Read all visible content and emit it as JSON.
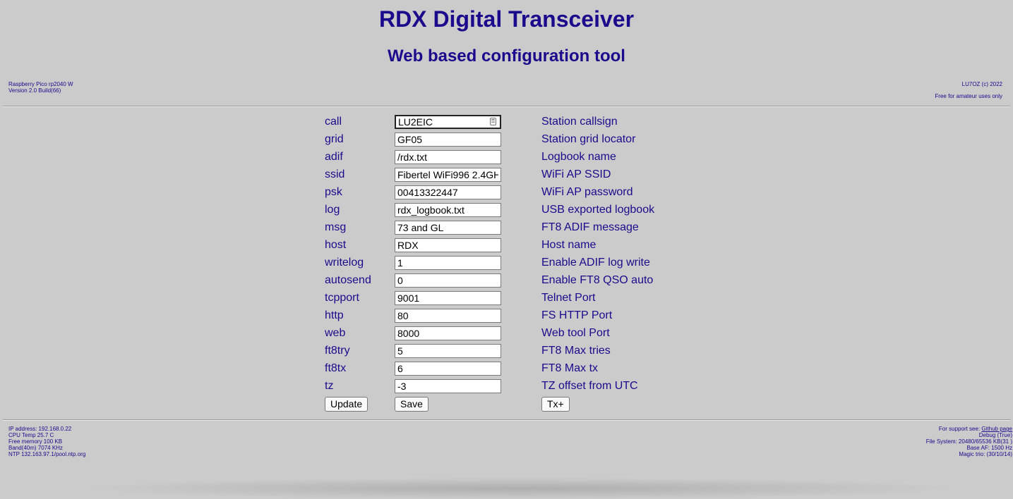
{
  "header": {
    "title": "RDX Digital Transceiver",
    "subtitle": "Web based configuration tool",
    "left_line1": "Raspberry Pico rp2040 W",
    "left_line2": "Version 2.0 Build(66)",
    "right_line1": "LU7OZ (c) 2022",
    "right_line2": "Free for amateur uses only"
  },
  "fields": [
    {
      "label": "call",
      "value": "LU2EIC",
      "description": "Station callsign"
    },
    {
      "label": "grid",
      "value": "GF05",
      "description": "Station grid locator"
    },
    {
      "label": "adif",
      "value": "/rdx.txt",
      "description": "Logbook name"
    },
    {
      "label": "ssid",
      "value": "Fibertel WiFi996 2.4GHz",
      "description": "WiFi AP SSID"
    },
    {
      "label": "psk",
      "value": "00413322447",
      "description": "WiFi AP password"
    },
    {
      "label": "log",
      "value": "rdx_logbook.txt",
      "description": "USB exported logbook"
    },
    {
      "label": "msg",
      "value": "73 and GL",
      "description": "FT8 ADIF message"
    },
    {
      "label": "host",
      "value": "RDX",
      "description": "Host name"
    },
    {
      "label": "writelog",
      "value": "1",
      "description": "Enable ADIF log write"
    },
    {
      "label": "autosend",
      "value": "0",
      "description": "Enable FT8 QSO auto"
    },
    {
      "label": "tcpport",
      "value": "9001",
      "description": "Telnet Port"
    },
    {
      "label": "http",
      "value": "80",
      "description": "FS HTTP Port"
    },
    {
      "label": "web",
      "value": "8000",
      "description": "Web tool Port"
    },
    {
      "label": "ft8try",
      "value": "5",
      "description": "FT8 Max tries"
    },
    {
      "label": "ft8tx",
      "value": "6",
      "description": "FT8 Max tx"
    },
    {
      "label": "tz",
      "value": "-3",
      "description": "TZ offset from UTC"
    }
  ],
  "buttons": {
    "update": "Update",
    "save": "Save",
    "tx": "Tx+"
  },
  "footer": {
    "left": [
      "IP address: 192.168.0.22",
      "CPU Temp 25.7 C",
      "Free memory 100 KB",
      "Band(40m) 7074 KHz",
      "NTP 132.163.97.1/pool.ntp.org"
    ],
    "support_prefix": "For support see: ",
    "support_link": "Github page",
    "right": [
      "Debug (True)",
      "File System: 20480/65536 KB(31 )",
      "Base AF: 1500 Hz",
      "Magic trio: (30/10/14)"
    ]
  },
  "colors": {
    "background": "#cbcbcb",
    "text": "#1a0a8c"
  }
}
